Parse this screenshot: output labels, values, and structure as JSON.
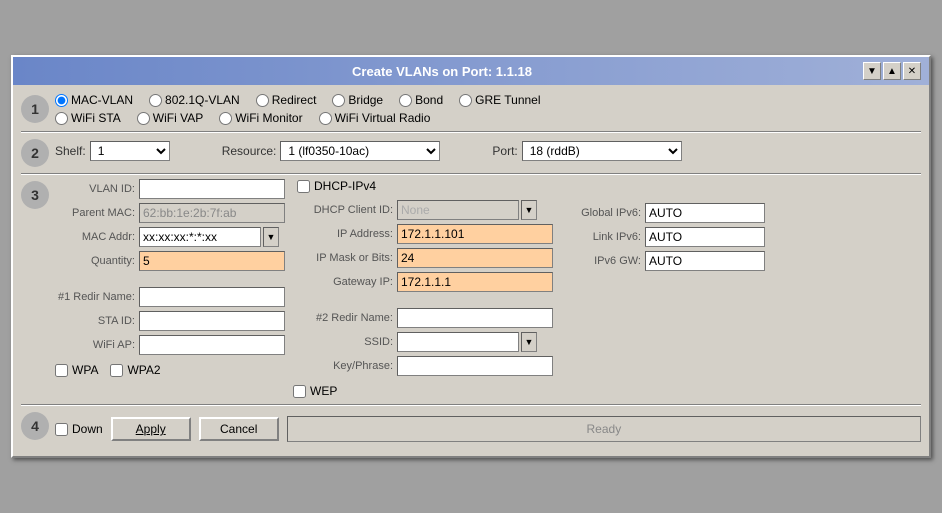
{
  "window": {
    "title": "Create VLANs on Port: 1.1.18",
    "minimize_btn": "▼",
    "restore_btn": "▲",
    "close_btn": "✕"
  },
  "section1": {
    "num": "1",
    "radios": [
      {
        "id": "r_macvlan",
        "label": "MAC-VLAN",
        "checked": true
      },
      {
        "id": "r_8021q",
        "label": "802.1Q-VLAN",
        "checked": false
      },
      {
        "id": "r_redirect",
        "label": "Redirect",
        "checked": false
      },
      {
        "id": "r_bridge",
        "label": "Bridge",
        "checked": false
      },
      {
        "id": "r_bond",
        "label": "Bond",
        "checked": false
      },
      {
        "id": "r_gretunnel",
        "label": "GRE Tunnel",
        "checked": false
      }
    ],
    "radios2": [
      {
        "id": "r_wifista",
        "label": "WiFi STA",
        "checked": false
      },
      {
        "id": "r_wifivap",
        "label": "WiFi VAP",
        "checked": false
      },
      {
        "id": "r_wifimonitor",
        "label": "WiFi Monitor",
        "checked": false
      },
      {
        "id": "r_wifivirtual",
        "label": "WiFi Virtual Radio",
        "checked": false
      }
    ]
  },
  "section2": {
    "num": "2",
    "shelf_label": "Shelf:",
    "shelf_value": "1",
    "resource_label": "Resource:",
    "resource_value": "1 (lf0350-10ac)",
    "port_label": "Port:",
    "port_value": "18 (rddB)"
  },
  "section3": {
    "num": "3",
    "vlan_id_label": "VLAN ID:",
    "vlan_id_value": "",
    "parent_mac_label": "Parent MAC:",
    "parent_mac_value": "62:bb:1e:2b:7f:ab",
    "mac_addr_label": "MAC Addr:",
    "mac_addr_value": "xx:xx:xx:*:*:xx",
    "quantity_label": "Quantity:",
    "quantity_value": "5",
    "dhcp_ipv4_label": "DHCP-IPv4",
    "dhcp_client_id_label": "DHCP Client ID:",
    "dhcp_client_id_value": "None",
    "ip_address_label": "IP Address:",
    "ip_address_value": "172.1.1.101",
    "ip_mask_label": "IP Mask or Bits:",
    "ip_mask_value": "24",
    "gateway_ip_label": "Gateway IP:",
    "gateway_ip_value": "172.1.1.1",
    "global_ipv6_label": "Global IPv6:",
    "global_ipv6_value": "AUTO",
    "link_ipv6_label": "Link IPv6:",
    "link_ipv6_value": "AUTO",
    "ipv6_gw_label": "IPv6 GW:",
    "ipv6_gw_value": "AUTO",
    "redir1_label": "#1 Redir Name:",
    "redir1_value": "",
    "redir2_label": "#2 Redir Name:",
    "redir2_value": "",
    "sta_id_label": "STA ID:",
    "sta_id_value": "",
    "ssid_label": "SSID:",
    "ssid_value": "",
    "wifi_ap_label": "WiFi AP:",
    "wifi_ap_value": "",
    "keyphrase_label": "Key/Phrase:",
    "keyphrase_value": "",
    "wpa_label": "WPA",
    "wpa2_label": "WPA2",
    "wep_label": "WEP"
  },
  "section4": {
    "num": "4",
    "down_label": "Down",
    "apply_label": "Apply",
    "cancel_label": "Cancel",
    "status_label": "Ready"
  }
}
